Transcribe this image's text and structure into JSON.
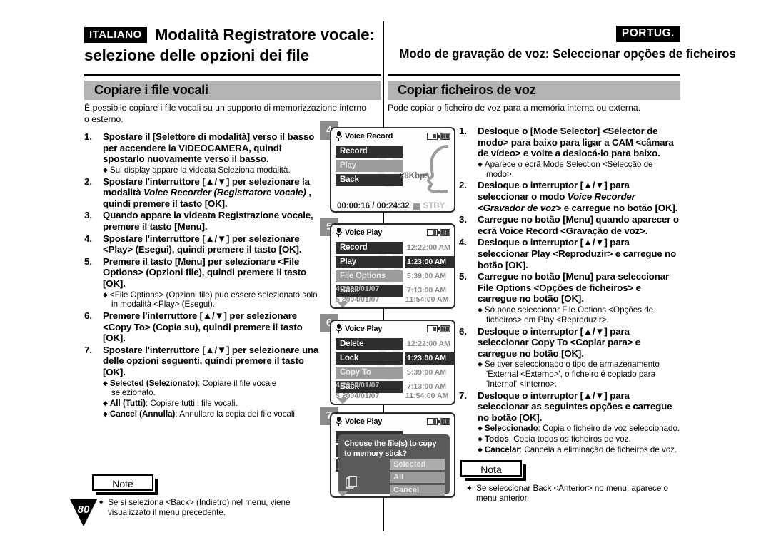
{
  "header": {
    "lang_left": "ITALIANO",
    "title_left_line1": "Modalità Registratore vocale:",
    "title_left_line2": "selezione delle opzioni dei file",
    "lang_right": "PORTUG.",
    "title_right": "Modo de gravação de voz: Seleccionar opções de ficheiros"
  },
  "sections": {
    "left_bar": "Copiare i file vocali",
    "right_bar": "Copiar ficheiros de voz"
  },
  "intro": {
    "left": "È possibile copiare i file vocali su un supporto di memorizzazione interno o esterno.",
    "right": "Pode copiar o ficheiro de voz para a memória interna ou externa."
  },
  "steps_left": [
    {
      "num": "1.",
      "text": "Spostare il [Selettore di modalità] verso il basso per accendere la VIDEOCAMERA, quindi spostarlo nuovamente verso il basso.",
      "bullets": [
        "Sul display appare la videata Seleziona modalità."
      ]
    },
    {
      "num": "2.",
      "text_pre": "Spostare l'interruttore [▲/▼] per selezionare la modalità ",
      "text_italic": "Voice Recorder (Registratore vocale)",
      "text_post": " , quindi premere il tasto [OK].",
      "bullets": []
    },
    {
      "num": "3.",
      "text": "Quando appare la videata Registrazione vocale, premere il tasto [Menu].",
      "bullets": []
    },
    {
      "num": "4.",
      "text": "Spostare l'interruttore [▲/▼] per selezionare <Play> (Esegui), quindi premere il tasto [OK].",
      "bullets": []
    },
    {
      "num": "5.",
      "text": "Premere il tasto [Menu] per selezionare <File Options> (Opzioni file), quindi premere il tasto [OK].",
      "bullets": [
        "<File Options> (Opzioni file) può essere selezionato solo in modalità <Play> (Esegui)."
      ]
    },
    {
      "num": "6.",
      "text": "Premere l'interruttore [▲/▼] per selezionare <Copy To> (Copia su), quindi premere il tasto [OK].",
      "bullets": []
    },
    {
      "num": "7.",
      "text": "Spostare l'interruttore [▲/▼] per selezionare una delle opzioni seguenti, quindi premere il tasto [OK].",
      "bullets_rich": [
        {
          "bold": "Selected (Selezionato)",
          "rest": ": Copiare il file vocale selezionato."
        },
        {
          "bold": "All (Tutti)",
          "rest": ": Copiare tutti i file vocali."
        },
        {
          "bold": "Cancel (Annulla)",
          "rest": ": Annullare la copia dei file vocali."
        }
      ]
    }
  ],
  "steps_right": [
    {
      "num": "1.",
      "text": "Desloque o [Mode Selector] <Selector de modo> para baixo para ligar a CAM <câmara de vídeo> e volte a deslocá-lo para baixo.",
      "bullets": [
        "Aparece o ecrã Mode Selection <Selecção de modo>."
      ]
    },
    {
      "num": "2.",
      "text_pre": "Desloque o interruptor [▲/▼] para seleccionar o modo ",
      "text_italic": "Voice Recorder <Gravador de voz>",
      "text_post": " e carregue no botão [OK].",
      "bullets": []
    },
    {
      "num": "3.",
      "text": "Carregue no botão [Menu] quando aparecer o ecrã Voice Record <Gravação de voz>.",
      "bullets": []
    },
    {
      "num": "4.",
      "text": "Desloque o interruptor [▲/▼] para seleccionar Play <Reproduzir> e carregue no botão [OK].",
      "bullets": []
    },
    {
      "num": "5.",
      "text": "Carregue no botão [Menu] para seleccionar File Options <Opções de ficheiros> e carregue no botão [OK].",
      "bullets": [
        "Só pode seleccionar File Options <Opções de ficheiros> em Play <Reproduzir>."
      ]
    },
    {
      "num": "6.",
      "text": "Desloque o interruptor [▲/▼] para seleccionar Copy To <Copiar para> e carregue no botão [OK].",
      "bullets": [
        "Se tiver seleccionado o tipo de armazenamento 'External <Externo>', o ficheiro é copiado para 'Internal' <Interno>."
      ]
    },
    {
      "num": "7.",
      "text": "Desloque o interruptor [▲/▼] para seleccionar as seguintes opções e carregue no botão [OK].",
      "bullets_rich": [
        {
          "bold": "Seleccionado",
          "rest": ": Copia o ficheiro de voz seleccionado."
        },
        {
          "bold": "Todos",
          "rest": ": Copia todos os ficheiros de voz."
        },
        {
          "bold": "Cancelar",
          "rest": ": Cancela a eliminação de ficheiros de voz."
        }
      ]
    }
  ],
  "notes": {
    "left_tag": "Note",
    "left_text": "Se si seleziona <Back> (Indietro) nel menu, viene visualizzato il menu precedente.",
    "right_tag": "Nota",
    "right_text": "Se seleccionar Back <Anterior> no menu, aparece o menu anterior."
  },
  "page_number": "80",
  "screens": [
    {
      "step": "4",
      "title": "Voice Record",
      "menu": [
        {
          "label": "Record",
          "selected": false
        },
        {
          "label": "Play",
          "selected": true
        },
        {
          "label": "Back",
          "selected": false
        }
      ],
      "kbps": "28Kbps",
      "watermark": "0",
      "recline": "00:00:16 / 00:24:32",
      "status": "STBY",
      "icons": [
        "memory-icon",
        "battery-icon"
      ]
    },
    {
      "step": "5",
      "title": "Voice Play",
      "menu": [
        {
          "label": "Record",
          "selected": false
        },
        {
          "label": "Play",
          "selected": false
        },
        {
          "label": "File Options",
          "selected": true
        },
        {
          "label": "Back",
          "selected": false
        }
      ],
      "times": [
        {
          "value": "12:22:00 AM",
          "active": false
        },
        {
          "value": "1:23:00 AM",
          "active": true
        },
        {
          "value": "5:39:00 AM",
          "active": false
        },
        {
          "value": "7:13:00 AM",
          "active": false
        }
      ],
      "file_rows": [
        "4  2004/01/07",
        "5  2004/01/07"
      ],
      "last_time": "11:54:00 AM",
      "watermark": "0",
      "icons": [
        "memory-icon",
        "battery-icon"
      ]
    },
    {
      "step": "6",
      "title": "Voice Play",
      "menu": [
        {
          "label": "Delete",
          "selected": false
        },
        {
          "label": "Lock",
          "selected": false
        },
        {
          "label": "Copy To",
          "selected": true
        },
        {
          "label": "Back",
          "selected": false
        }
      ],
      "times": [
        {
          "value": "12:22:00 AM",
          "active": false
        },
        {
          "value": "1:23:00 AM",
          "active": true
        },
        {
          "value": "5:39:00 AM",
          "active": false
        },
        {
          "value": "7:13:00 AM",
          "active": false
        }
      ],
      "file_rows": [
        "4  2004/01/07",
        "5  2004/01/07"
      ],
      "last_time": "11:54:00 AM",
      "watermark": "0",
      "icons": [
        "memory-icon",
        "battery-icon"
      ]
    },
    {
      "step": "7",
      "title": "Voice Play",
      "dialog": {
        "message_line1": "Choose the file(s) to copy",
        "message_line2": "to memory stick?",
        "options": [
          "Selected",
          "All",
          "Cancel"
        ]
      },
      "icons": [
        "memory-icon",
        "battery-icon"
      ]
    }
  ]
}
